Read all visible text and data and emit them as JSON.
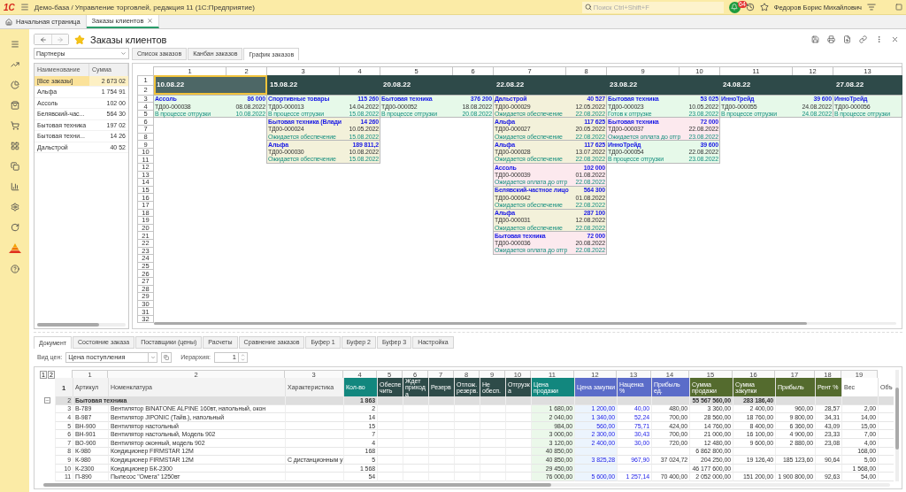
{
  "titlebar": {
    "logo": "1С",
    "title": "Демо-база / Управление торговлей, редакция 11  (1С:Предприятие)",
    "search_placeholder": "Поиск Ctrl+Shift+F",
    "notifications": "64",
    "user": "Федоров Борис Михайлович"
  },
  "tabs": [
    {
      "label": "Начальная страница",
      "kind": "home",
      "selected": false
    },
    {
      "label": "Заказы клиентов",
      "kind": "document",
      "selected": true
    }
  ],
  "page": {
    "title": "Заказы клиентов"
  },
  "partners": {
    "filter": "Партнеры",
    "columns": [
      "Наименование",
      "Сумма"
    ],
    "rows": [
      {
        "name": "[Все заказы]",
        "sum": "2 673 02",
        "selected": true
      },
      {
        "name": "Альфа",
        "sum": "1 754 91",
        "selected": false
      },
      {
        "name": "Ассоль",
        "sum": "102 00",
        "selected": false
      },
      {
        "name": "Белявский-час...",
        "sum": "564 30",
        "selected": false
      },
      {
        "name": "Бытовая техника",
        "sum": "197 02",
        "selected": false
      },
      {
        "name": "Бытовая техни...",
        "sum": "14 26",
        "selected": false
      },
      {
        "name": "Дальстрой",
        "sum": "40 52",
        "selected": false
      }
    ]
  },
  "views": [
    {
      "label": "Список заказов",
      "selected": false
    },
    {
      "label": "Канбан заказов",
      "selected": false
    },
    {
      "label": "График заказов",
      "selected": true
    }
  ],
  "schedule": {
    "column_numbers": [
      "1",
      "2",
      "3",
      "4",
      "5",
      "6",
      "7",
      "8",
      "9",
      "10",
      "11",
      "12",
      "13"
    ],
    "row_numbers": [
      "1",
      "2",
      "3",
      "4",
      "5",
      "6",
      "7",
      "8",
      "9",
      "10",
      "11",
      "12",
      "13",
      "14",
      "15",
      "16",
      "17",
      "18",
      "19",
      "20",
      "21",
      "22",
      "23",
      "24",
      "25",
      "26",
      "27",
      "28",
      "29",
      "30",
      "31",
      "32"
    ],
    "days": [
      {
        "date": "10.08.22",
        "selected": true,
        "orders": [
          {
            "customer": "Ассоль",
            "amount": "86 000",
            "number": "ТД00-000038",
            "date": "08.08.2022",
            "status": "В процессе отгрузки",
            "ship_date": "10.08.2022",
            "color": "#e6f9e9"
          }
        ]
      },
      {
        "date": "15.08.22",
        "selected": false,
        "orders": [
          {
            "customer": "Спортивные товары",
            "amount": "115 260",
            "number": "ТД00-000013",
            "date": "14.04.2022",
            "status": "В процессе отгрузки",
            "ship_date": "15.08.2022",
            "color": "#e6f9e9"
          },
          {
            "customer": "Бытовая техника (Влади",
            "amount": "14 260",
            "number": "ТД00-000024",
            "date": "10.05.2022",
            "status": "Ожидается обеспечение",
            "ship_date": "15.08.2022",
            "color": "#f3f1da"
          },
          {
            "customer": "Альфа",
            "amount": "189 811,2",
            "number": "ТД00-000030",
            "date": "10.08.2022",
            "status": "Ожидается обеспечение",
            "ship_date": "15.08.2022",
            "color": "#f3f1da"
          }
        ]
      },
      {
        "date": "20.08.22",
        "selected": false,
        "orders": [
          {
            "customer": "Бытовая техника",
            "amount": "376 200",
            "number": "ТД00-000052",
            "date": "18.08.2022",
            "status": "В процессе отгрузки",
            "ship_date": "20.08.2022",
            "color": "#e6f9e9"
          }
        ]
      },
      {
        "date": "22.08.22",
        "selected": false,
        "orders": [
          {
            "customer": "Дальстрой",
            "amount": "40 527",
            "number": "ТД00-000029",
            "date": "12.05.2022",
            "status": "Ожидается обеспечение",
            "ship_date": "22.08.2022",
            "color": "#f3f1da"
          },
          {
            "customer": "Альфа",
            "amount": "117 625",
            "number": "ТД00-000027",
            "date": "20.05.2022",
            "status": "Ожидается обеспечение",
            "ship_date": "22.08.2022",
            "color": "#f3f1da"
          },
          {
            "customer": "Альфа",
            "amount": "117 625",
            "number": "ТД00-000028",
            "date": "13.07.2022",
            "status": "Ожидается обеспечение",
            "ship_date": "22.08.2022",
            "color": "#f3f1da"
          },
          {
            "customer": "Ассоль",
            "amount": "102 000",
            "number": "ТД00-000039",
            "date": "01.08.2022",
            "status": "Ожидается оплата до отгр",
            "ship_date": "22.08.2022",
            "color": "#fce9ee"
          },
          {
            "customer": "Белявский-частное лицо",
            "amount": "564 300",
            "number": "ТД00-000042",
            "date": "01.08.2022",
            "status": "Ожидается обеспечение",
            "ship_date": "22.08.2022",
            "color": "#f3f1da"
          },
          {
            "customer": "Альфа",
            "amount": "287 100",
            "number": "ТД00-000031",
            "date": "12.08.2022",
            "status": "Ожидается обеспечение",
            "ship_date": "22.08.2022",
            "color": "#f3f1da"
          },
          {
            "customer": "Бытовая техника",
            "amount": "72 000",
            "number": "ТД00-000036",
            "date": "20.08.2022",
            "status": "Ожидается оплата до отгр",
            "ship_date": "22.08.2022",
            "color": "#fce9ee"
          }
        ]
      },
      {
        "date": "23.08.22",
        "selected": false,
        "orders": [
          {
            "customer": "Бытовая техника",
            "amount": "53 025",
            "number": "ТД00-000023",
            "date": "10.05.2022",
            "status": "Готов к отгрузке",
            "ship_date": "23.08.2022",
            "color": "#e6f9e9"
          },
          {
            "customer": "Бытовая техника",
            "amount": "72 000",
            "number": "ТД00-000037",
            "date": "22.08.2022",
            "status": "Ожидается оплата до отгр",
            "ship_date": "23.08.2022",
            "color": "#fce9ee"
          },
          {
            "customer": "ИнноТрейд",
            "amount": "39 600",
            "number": "ТД00-000054",
            "date": "22.08.2022",
            "status": "В процессе отгрузки",
            "ship_date": "23.08.2022",
            "color": "#e6f9e9"
          }
        ]
      },
      {
        "date": "24.08.22",
        "selected": false,
        "orders": [
          {
            "customer": "ИнноТрейд",
            "amount": "39 600",
            "number": "ТД00-000055",
            "date": "24.08.2022",
            "status": "В процессе отгрузки",
            "ship_date": "24.08.2022",
            "color": "#e6f9e9"
          }
        ]
      },
      {
        "date": "27.08.22",
        "selected": false,
        "orders": [
          {
            "customer": "ИнноТрейд",
            "number": "ТД00-000056",
            "status": "В процессе отгрузки",
            "color": "#e6f9e9"
          }
        ]
      }
    ]
  },
  "details": {
    "tabs": [
      {
        "label": "Документ",
        "selected": true
      },
      {
        "label": "Состояние заказа",
        "selected": false
      },
      {
        "label": "Поставщики (цены)",
        "selected": false
      },
      {
        "label": "Расчеты",
        "selected": false
      },
      {
        "label": "Сравнение заказов",
        "selected": false
      },
      {
        "label": "Буфер 1",
        "selected": false
      },
      {
        "label": "Буфер 2",
        "selected": false
      },
      {
        "label": "Буфер 3",
        "selected": false
      },
      {
        "label": "Настройка",
        "selected": false
      }
    ],
    "price_type_label": "Вид цен:",
    "price_type": "Цена поступления",
    "hierarchy_label": "Иерархия:",
    "hierarchy": "1",
    "level_buttons": [
      "1",
      "2"
    ],
    "header_row": "1",
    "columns": [
      {
        "num": "1",
        "title": "Артикул",
        "kind": "text"
      },
      {
        "num": "2",
        "title": "Номенклатура",
        "kind": "text"
      },
      {
        "num": "3",
        "title": "Характеристика",
        "kind": "text"
      },
      {
        "num": "4",
        "title": "Кол-во",
        "kind": "number",
        "color": "#12877e"
      },
      {
        "num": "5",
        "title": "Обеспечить",
        "kind": "number",
        "color": "#2e4b49"
      },
      {
        "num": "6",
        "title": "Ждет прихода",
        "kind": "number",
        "color": "#2e4b49"
      },
      {
        "num": "7",
        "title": "Резерв",
        "kind": "number",
        "color": "#2e4b49"
      },
      {
        "num": "8",
        "title": "Отлож. резерв.",
        "kind": "number",
        "color": "#2e4b49"
      },
      {
        "num": "9",
        "title": "Не обесп.",
        "kind": "number",
        "color": "#2e4b49"
      },
      {
        "num": "10",
        "title": "Отгрузка",
        "kind": "number",
        "color": "#2e4b49"
      },
      {
        "num": "11",
        "title": "Цена продажи",
        "kind": "sale",
        "color": "#12877e"
      },
      {
        "num": "12",
        "title": "Цена закупки",
        "kind": "purchase",
        "color": "#5b6cc9"
      },
      {
        "num": "13",
        "title": "Наценка %",
        "kind": "markup",
        "color": "#5b6cc9"
      },
      {
        "num": "14",
        "title": "Прибыль ед.",
        "kind": "number",
        "color": "#5b6cc9"
      },
      {
        "num": "15",
        "title": "Сумма продажи",
        "kind": "number",
        "color": "#546b2e"
      },
      {
        "num": "16",
        "title": "Сумма закупки",
        "kind": "number",
        "color": "#546b2e"
      },
      {
        "num": "17",
        "title": "Прибыль",
        "kind": "number",
        "color": "#546b2e"
      },
      {
        "num": "18",
        "title": "Рент %",
        "kind": "number",
        "color": "#546b2e"
      },
      {
        "num": "19",
        "title": "Вес",
        "kind": "number"
      },
      {
        "title": "Объ",
        "kind": "number"
      }
    ],
    "rows": [
      {
        "num": "2",
        "kind": "group",
        "expanded": true,
        "cells": [
          "Бытовая техника",
          null,
          null,
          "1 863",
          null,
          null,
          null,
          null,
          null,
          null,
          null,
          null,
          null,
          null,
          "55 567 560,00",
          "283 186,40",
          null,
          null,
          null,
          null
        ]
      },
      {
        "num": "3",
        "kind": "item",
        "cells": [
          "В-789",
          "Вентилятор BINATONE ALPINE 160вт, напольный, окон",
          null,
          "2",
          null,
          null,
          null,
          null,
          null,
          null,
          "1 680,00",
          "1 200,00",
          "40,00",
          "480,00",
          "3 360,00",
          "2 400,00",
          "960,00",
          "28,57",
          "2,00",
          null
        ]
      },
      {
        "num": "4",
        "kind": "item",
        "cells": [
          "В-987",
          "Вентилятор JIPONIC (Тайв.), напольный",
          null,
          "14",
          null,
          null,
          null,
          null,
          null,
          null,
          "2 040,00",
          "1 340,00",
          "52,24",
          "700,00",
          "28 560,00",
          "18 760,00",
          "9 800,00",
          "34,31",
          "14,00",
          null
        ]
      },
      {
        "num": "5",
        "kind": "item",
        "cells": [
          "ВН-900",
          "Вентилятор настольный",
          null,
          "15",
          null,
          null,
          null,
          null,
          null,
          null,
          "984,00",
          "560,00",
          "75,71",
          "424,00",
          "14 760,00",
          "8 400,00",
          "6 360,00",
          "43,09",
          "15,00",
          null
        ]
      },
      {
        "num": "6",
        "kind": "item",
        "cells": [
          "ВН-901",
          "Вентилятор настольный, Модель 902",
          null,
          "7",
          null,
          null,
          null,
          null,
          null,
          null,
          "3 000,00",
          "2 300,00",
          "30,43",
          "700,00",
          "21 000,00",
          "16 100,00",
          "4 900,00",
          "23,33",
          "7,00",
          null
        ]
      },
      {
        "num": "7",
        "kind": "item",
        "cells": [
          "ВО-900",
          "Вентилятор оконный, модель 902",
          null,
          "4",
          null,
          null,
          null,
          null,
          null,
          null,
          "3 120,00",
          "2 400,00",
          "30,00",
          "720,00",
          "12 480,00",
          "9 600,00",
          "2 880,00",
          "23,08",
          "4,00",
          null
        ]
      },
      {
        "num": "8",
        "kind": "item",
        "cells": [
          "К-980",
          "Кондиционер FIRMSTAR 12М",
          null,
          "168",
          null,
          null,
          null,
          null,
          null,
          null,
          "40 850,00",
          null,
          null,
          null,
          "6 862 800,00",
          null,
          null,
          null,
          "168,00",
          null
        ]
      },
      {
        "num": "9",
        "kind": "item",
        "cells": [
          "К-980",
          "Кондиционер FIRMSTAR 12М",
          "С дистанционным у",
          "5",
          null,
          null,
          null,
          null,
          null,
          null,
          "40 850,00",
          "3 825,28",
          "967,90",
          "37 024,72",
          "204 250,00",
          "19 126,40",
          "185 123,60",
          "90,64",
          "5,00",
          null
        ]
      },
      {
        "num": "10",
        "kind": "item",
        "cells": [
          "К-2300",
          "Кондиционер БК-2300",
          null,
          "1 568",
          null,
          null,
          null,
          null,
          null,
          null,
          "29 450,00",
          null,
          null,
          null,
          "46 177 600,00",
          null,
          null,
          null,
          "1 568,00",
          null
        ]
      },
      {
        "num": "11",
        "kind": "item",
        "cells": [
          "П-890",
          "Пылесос \"Омега\" 1250вт",
          null,
          "54",
          null,
          null,
          null,
          null,
          null,
          null,
          "76 000,00",
          "5 600,00",
          "1 257,14",
          "70 400,00",
          "2 052 000,00",
          "151 200,00",
          "1 900 800,00",
          "92,63",
          "54,00",
          null
        ]
      }
    ]
  }
}
